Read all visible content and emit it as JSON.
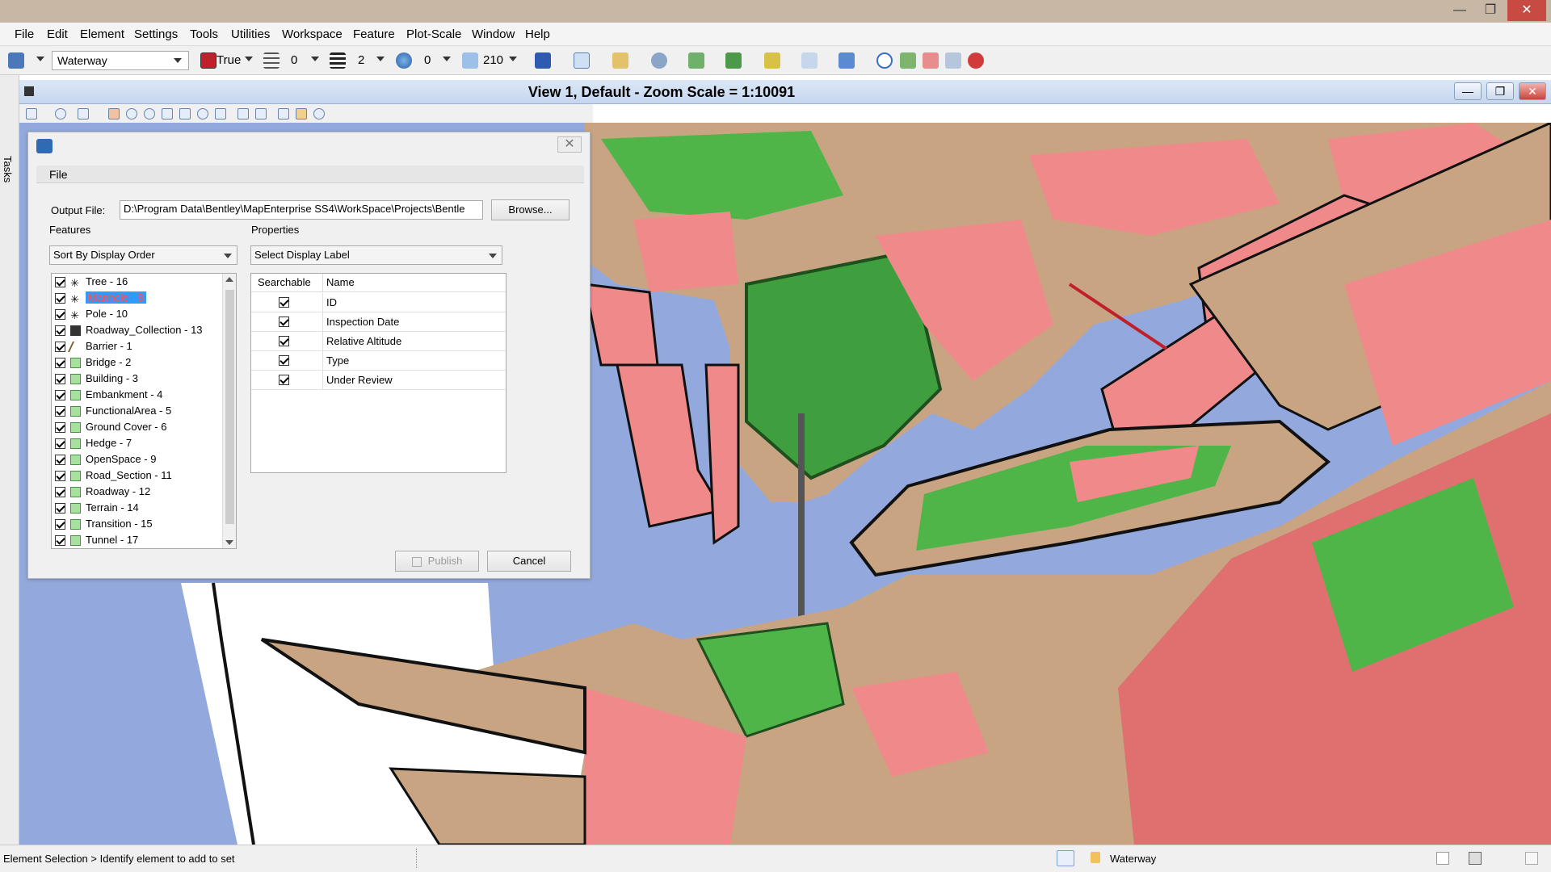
{
  "menubar": {
    "items": [
      "File",
      "Edit",
      "Element",
      "Settings",
      "Tools",
      "Utilities",
      "Workspace",
      "Feature",
      "Plot-Scale",
      "Window",
      "Help"
    ]
  },
  "toolbar": {
    "level_value": "Waterway",
    "color_value": "True",
    "style_value": "0",
    "weight_value": "2",
    "transparency_value": "0",
    "priority_value": "210"
  },
  "left_strip": {
    "tasks_label": "Tasks"
  },
  "view": {
    "title": "View 1, Default - Zoom Scale = 1:10091"
  },
  "dialog": {
    "menu_file": "File",
    "output_file_label": "Output File:",
    "output_file_value": "D:\\Program Data\\Bentley\\MapEnterprise SS4\\WorkSpace\\Projects\\Bentle",
    "browse_button": "Browse...",
    "features_label": "Features",
    "sort_value": "Sort By Display Order",
    "properties_label": "Properties",
    "display_label_value": "Select Display Label",
    "features": [
      {
        "label": "Tree - 16",
        "icon": "point-feature-icon"
      },
      {
        "label": "Manhole - 8",
        "icon": "point-feature-icon",
        "selected": true
      },
      {
        "label": "Pole - 10",
        "icon": "point-feature-icon"
      },
      {
        "label": "Roadway_Collection - 13",
        "icon": "collection-feature-icon"
      },
      {
        "label": "Barrier - 1",
        "icon": "line-feature-icon"
      },
      {
        "label": "Bridge - 2",
        "icon": "polygon-feature-icon"
      },
      {
        "label": "Building - 3",
        "icon": "polygon-feature-icon"
      },
      {
        "label": "Embankment - 4",
        "icon": "polygon-feature-icon"
      },
      {
        "label": "FunctionalArea - 5",
        "icon": "polygon-feature-icon"
      },
      {
        "label": "Ground Cover - 6",
        "icon": "polygon-feature-icon"
      },
      {
        "label": "Hedge - 7",
        "icon": "polygon-feature-icon"
      },
      {
        "label": "OpenSpace - 9",
        "icon": "polygon-feature-icon"
      },
      {
        "label": "Road_Section - 11",
        "icon": "polygon-feature-icon"
      },
      {
        "label": "Roadway - 12",
        "icon": "polygon-feature-icon"
      },
      {
        "label": "Terrain - 14",
        "icon": "polygon-feature-icon"
      },
      {
        "label": "Transition - 15",
        "icon": "polygon-feature-icon"
      },
      {
        "label": "Tunnel - 17",
        "icon": "polygon-feature-icon"
      }
    ],
    "prop_columns": [
      "Searchable",
      "Name"
    ],
    "properties": [
      {
        "name": "ID",
        "searchable": true
      },
      {
        "name": "Inspection Date",
        "searchable": true
      },
      {
        "name": "Relative Altitude",
        "searchable": true
      },
      {
        "name": "Type",
        "searchable": true
      },
      {
        "name": "Under Review",
        "searchable": true
      }
    ],
    "publish_button": "Publish",
    "cancel_button": "Cancel"
  },
  "statusbar": {
    "prompt": "Element Selection > Identify element to add to set",
    "active_level": "Waterway"
  },
  "colors": {
    "water": "#93a9dd",
    "building": "#f08a8a",
    "green": "#4fb548",
    "land": "#c9a482",
    "selection": "#3399ff"
  }
}
